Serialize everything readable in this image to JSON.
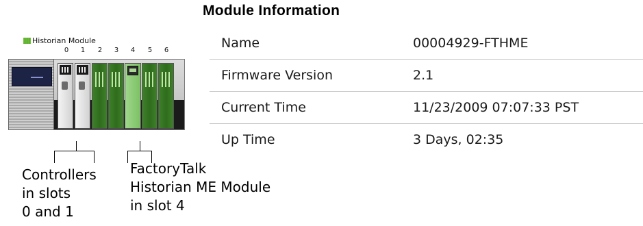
{
  "heading": "Module Information",
  "module_info": [
    {
      "label": "Name",
      "value": "00004929-FTHME"
    },
    {
      "label": "Firmware Version",
      "value": "2.1"
    },
    {
      "label": "Current Time",
      "value": "11/23/2009 07:07:33 PST"
    },
    {
      "label": "Up Time",
      "value": "3 Days, 02:35"
    }
  ],
  "chassis": {
    "legend_label": "Historian Module",
    "slot_numbers": [
      "0",
      "1",
      "2",
      "3",
      "4",
      "5",
      "6"
    ]
  },
  "annotations": {
    "controllers": [
      "Controllers",
      "in slots",
      "0 and 1"
    ],
    "historian": [
      "FactoryTalk",
      "Historian ME Module",
      "in slot 4"
    ]
  },
  "colors": {
    "historian_module": "#7cc064",
    "io_module": "#2f6d1d",
    "controller_module": "#e6e6e6"
  }
}
